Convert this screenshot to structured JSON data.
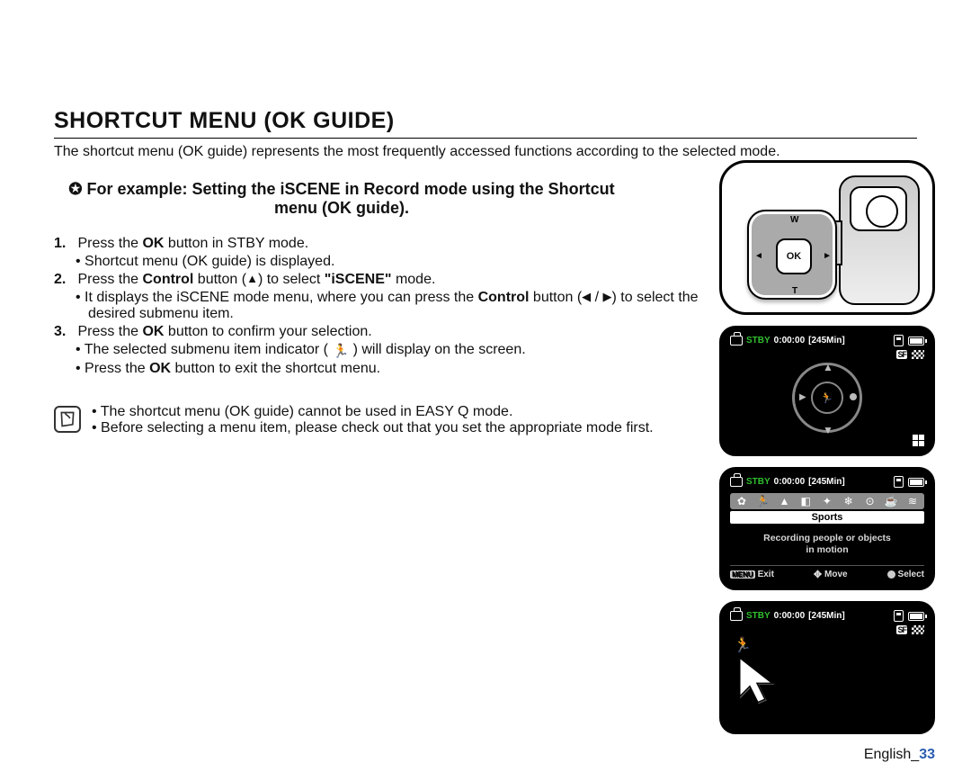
{
  "title": "SHORTCUT MENU (OK GUIDE)",
  "intro": "The shortcut menu (OK guide) represents the most frequently accessed functions according to the selected mode.",
  "example_lead": "✪ For example: Setting the iSCENE in Record mode using the Shortcut menu (OK guide).",
  "steps": {
    "s1": {
      "num": "1.",
      "t1a": "Press the ",
      "t1b": "OK",
      "t1c": " button in STBY mode.",
      "b1": "Shortcut menu (OK guide) is displayed."
    },
    "s2": {
      "num": "2.",
      "t1a": "Press the ",
      "t1b": "Control",
      "t1c": " button (",
      "t1d": ") to select ",
      "t1e": "\"iSCENE\"",
      "t1f": "  mode.",
      "b1a": "It displays the iSCENE mode menu, where you can press the ",
      "b1b": "Control",
      "b1c": " button (",
      "b1d": " / ",
      "b1e": ") to select the desired submenu item."
    },
    "s3": {
      "num": "3.",
      "t1a": "Press the ",
      "t1b": "OK",
      "t1c": " button to confirm your selection.",
      "b1a": "The selected submenu item indicator ( ",
      "b1b": " ) will display on the screen.",
      "b2a": "Press the ",
      "b2b": "OK",
      "b2c": " button to exit the shortcut menu."
    }
  },
  "notes": {
    "n1": "The shortcut menu (OK guide) cannot be used in EASY Q mode.",
    "n2": "Before selecting a menu item, please check out that you set the appropriate mode first."
  },
  "okpad": {
    "ok": "OK",
    "w": "W",
    "t": "T",
    "l": "◄",
    "r": "►"
  },
  "lcd": {
    "stby": "STBY",
    "timecode": "0:00:00",
    "remain": "[245Min]",
    "sf": "SF",
    "sports": "Sports",
    "desc1": "Recording people or objects",
    "desc2": "in motion",
    "menu": "MENU",
    "exit": "Exit",
    "move": "Move",
    "select": "Select",
    "iscene_core": "🏃"
  },
  "footer": {
    "lang": "English",
    "sep": "_",
    "page": "33"
  },
  "glyphs": {
    "up": "▲",
    "left": "◀",
    "right": "▶",
    "runner": "🏃"
  }
}
